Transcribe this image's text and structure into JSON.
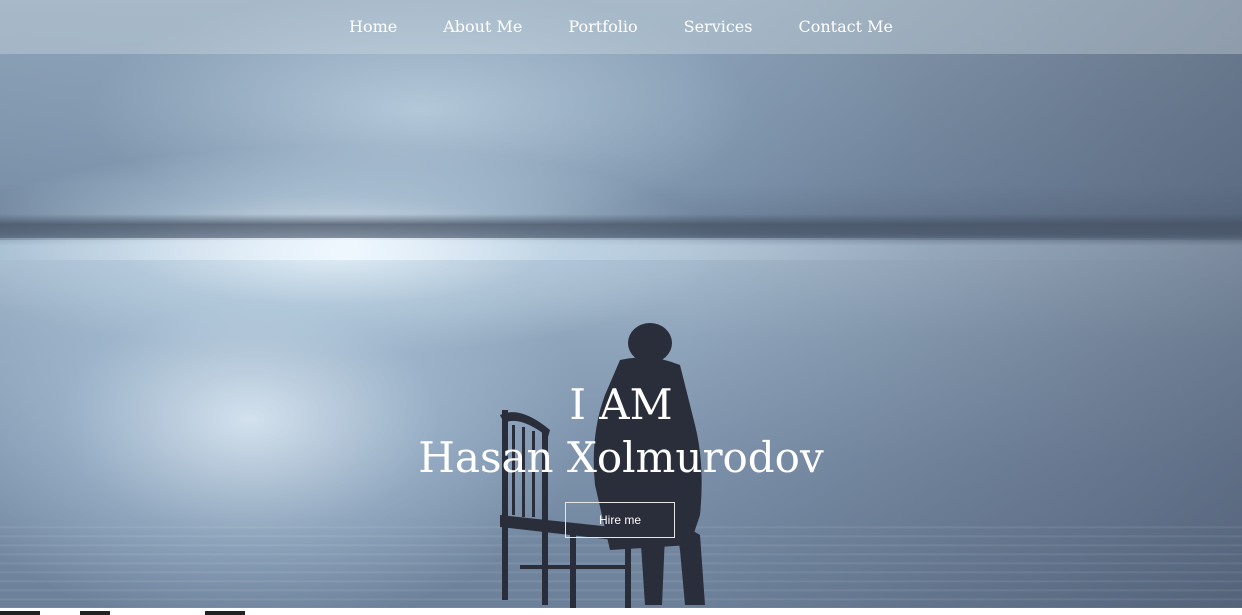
{
  "nav": {
    "items": [
      {
        "label": "Home"
      },
      {
        "label": "About Me"
      },
      {
        "label": "Portfolio"
      },
      {
        "label": "Services"
      },
      {
        "label": "Contact Me"
      }
    ]
  },
  "hero": {
    "line1": "I AM",
    "line2": "Hasan Xolmurodov",
    "button_label": "Hire me"
  },
  "colors": {
    "text": "#ffffff",
    "nav_bg": "rgba(215,225,232,0.35)",
    "button_border": "#e6e6e6"
  }
}
